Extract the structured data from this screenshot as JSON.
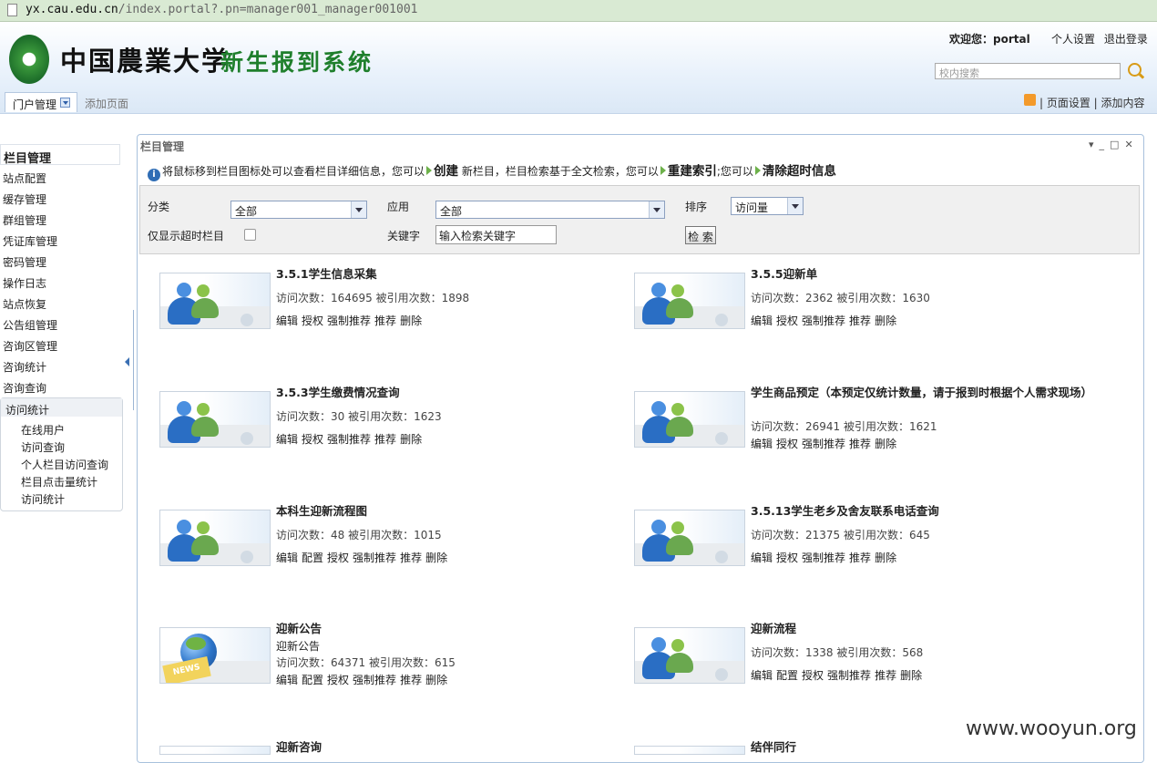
{
  "browser": {
    "url_host": "yx.cau.edu.cn",
    "url_path": "/index.portal?.pn=manager001_manager001001"
  },
  "header": {
    "title": "中国農業大学",
    "subtitle": "新生报到系统",
    "welcome": "欢迎您：portal",
    "links": [
      "个人设置",
      "退出登录"
    ],
    "search_placeholder": "校内搜索"
  },
  "tabs": {
    "active": "门户管理",
    "add_page": "添加页面"
  },
  "page_links": "| 页面设置 | 添加内容",
  "sidebar": {
    "active": "栏目管理",
    "items": [
      "站点配置",
      "缓存管理",
      "群组管理",
      "凭证库管理",
      "密码管理",
      "操作日志",
      "站点恢复",
      "公告组管理",
      "咨询区管理",
      "咨询统计",
      "咨询查询"
    ],
    "group": {
      "label": "访问统计",
      "children": [
        "在线用户",
        "访问查询",
        "个人栏目访问查询",
        "栏目点击量统计",
        "访问统计"
      ]
    }
  },
  "panel": {
    "title": "栏目管理",
    "info": {
      "prefix": "将鼠标移到栏目图标处可以查看栏目详细信息，您可以",
      "create": "创建",
      "mid1": "新栏目，栏目检索基于全文检索，您可以",
      "reindex": "重建索引",
      "mid2": ";您可以",
      "clear": "清除超时信息"
    },
    "filter": {
      "category_label": "分类",
      "category_value": "全部",
      "app_label": "应用",
      "app_value": "全部",
      "sort_label": "排序",
      "sort_value": "访问量",
      "timeout_label": "仅显示超时栏目",
      "keyword_label": "关键字",
      "keyword_value": "输入检索关键字",
      "search_button": "检 索"
    },
    "items": [
      {
        "title": "3.5.1学生信息采集",
        "stat": "访问次数：164695 被引用次数：1898",
        "actions": [
          "编辑",
          "授权",
          "强制推荐",
          "推荐",
          "删除"
        ]
      },
      {
        "title": "3.5.5迎新单",
        "stat": "访问次数：2362 被引用次数：1630",
        "actions": [
          "编辑",
          "授权",
          "强制推荐",
          "推荐",
          "删除"
        ]
      },
      {
        "title": "3.5.3学生缴费情况查询",
        "stat": "访问次数：30 被引用次数：1623",
        "actions": [
          "编辑",
          "授权",
          "强制推荐",
          "推荐",
          "删除"
        ]
      },
      {
        "title": "学生商品预定（本预定仅统计数量，请于报到时根据个人需求现场）",
        "stat": "访问次数：26941 被引用次数：1621",
        "actions": [
          "编辑",
          "授权",
          "强制推荐",
          "推荐",
          "删除"
        ]
      },
      {
        "title": "本科生迎新流程图",
        "stat": "访问次数：48 被引用次数：1015",
        "actions": [
          "编辑",
          "配置",
          "授权",
          "强制推荐",
          "推荐",
          "删除"
        ]
      },
      {
        "title": "3.5.13学生老乡及舍友联系电话查询",
        "stat": "访问次数：21375 被引用次数：645",
        "actions": [
          "编辑",
          "授权",
          "强制推荐",
          "推荐",
          "删除"
        ]
      },
      {
        "title": "迎新公告",
        "subtitle": "迎新公告",
        "stat": "访问次数：64371 被引用次数：615",
        "actions": [
          "编辑",
          "配置",
          "授权",
          "强制推荐",
          "推荐",
          "删除"
        ],
        "icon": "news-globe-icon"
      },
      {
        "title": "迎新流程",
        "stat": "访问次数：1338 被引用次数：568",
        "actions": [
          "编辑",
          "配置",
          "授权",
          "强制推荐",
          "推荐",
          "删除"
        ]
      },
      {
        "title": "迎新咨询"
      },
      {
        "title": "结伴同行"
      }
    ]
  },
  "watermark": "www.wooyun.org"
}
